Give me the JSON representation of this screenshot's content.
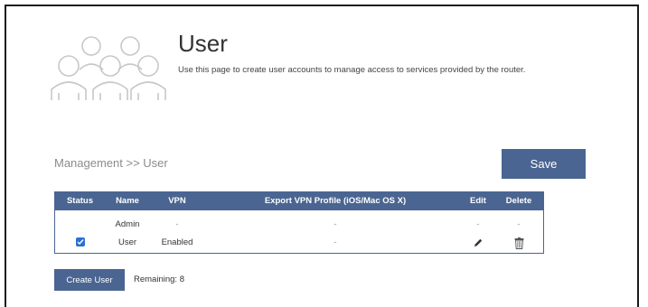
{
  "header": {
    "title": "User",
    "description": "Use this page to create user accounts to manage access to services provided by the router.",
    "illustration_icon": "users-group-icon"
  },
  "breadcrumb": "Management >> User",
  "toolbar": {
    "save_label": "Save"
  },
  "table": {
    "columns": [
      "Status",
      "Name",
      "VPN",
      "Export VPN Profile (iOS/Mac OS X)",
      "Edit",
      "Delete"
    ],
    "rows": [
      {
        "status": "",
        "name": "Admin",
        "vpn": "-",
        "export": "-",
        "edit": "-",
        "delete": "-"
      },
      {
        "status": "checked",
        "name": "User",
        "vpn": "Enabled",
        "export": "-",
        "edit_icon": "pencil-icon",
        "delete_icon": "trash-icon"
      }
    ]
  },
  "create_user_label": "Create User",
  "remaining_text": "Remaining: 8",
  "colors": {
    "accent": "#4a6591",
    "checkbox": "#2b6fd6"
  }
}
